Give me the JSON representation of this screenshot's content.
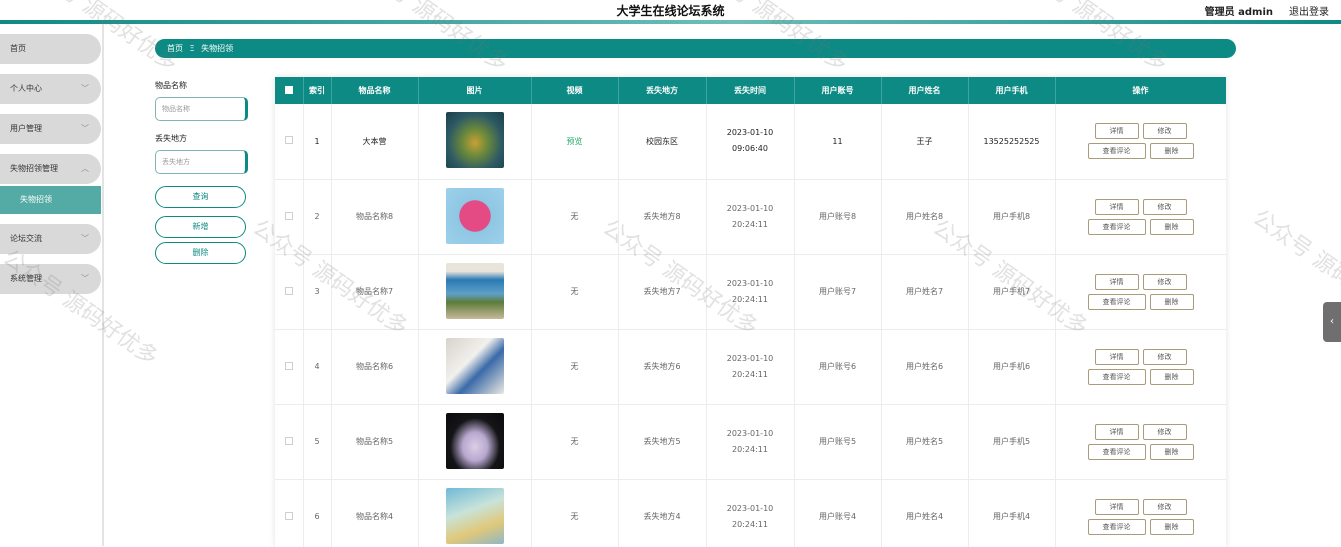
{
  "header": {
    "title": "大学生在线论坛系统",
    "admin_label": "管理员 admin",
    "logout_label": "退出登录"
  },
  "sidebar": {
    "items": [
      {
        "label": "首页",
        "chevron": false
      },
      {
        "label": "个人中心",
        "chevron": true
      },
      {
        "label": "用户管理",
        "chevron": true
      },
      {
        "label": "失物招领管理",
        "chevron": true
      },
      {
        "label": "论坛交流",
        "chevron": true
      },
      {
        "label": "系统管理",
        "chevron": true
      }
    ],
    "subitem": "失物招领"
  },
  "breadcrumb": {
    "home": "首页",
    "separator": "Ξ",
    "current": "失物招领"
  },
  "filters": {
    "item_name_label": "物品名称",
    "item_name_placeholder": "物品名称",
    "lost_place_label": "丢失地方",
    "lost_place_placeholder": "丢失地方",
    "query_button": "查询",
    "add_button": "新增",
    "delete_button": "删除"
  },
  "table": {
    "columns": [
      "",
      "索引",
      "物品名称",
      "图片",
      "视频",
      "丢失地方",
      "丢失时间",
      "用户账号",
      "用户姓名",
      "用户手机",
      "操作"
    ],
    "actions": {
      "detail": "详情",
      "edit": "修改",
      "comments": "查看评论",
      "delete": "删除"
    },
    "rows": [
      {
        "index": "1",
        "name": "大本营",
        "video": "预览",
        "place": "校园东区",
        "time": "2023-01-10 09:06:40",
        "account": "11",
        "username": "王子",
        "phone": "13525252525",
        "image_icon": "vase-photo"
      },
      {
        "index": "2",
        "name": "物品名称8",
        "video": "无",
        "place": "丢失地方8",
        "time": "2023-01-10 20:24:11",
        "account": "用户账号8",
        "username": "用户姓名8",
        "phone": "用户手机8",
        "image_icon": "pink-tag-photo"
      },
      {
        "index": "3",
        "name": "物品名称7",
        "video": "无",
        "place": "丢失地方7",
        "time": "2023-01-10 20:24:11",
        "account": "用户账号7",
        "username": "用户姓名7",
        "phone": "用户手机7",
        "image_icon": "card-photo"
      },
      {
        "index": "4",
        "name": "物品名称6",
        "video": "无",
        "place": "丢失地方6",
        "time": "2023-01-10 20:24:11",
        "account": "用户账号6",
        "username": "用户姓名6",
        "phone": "用户手机6",
        "image_icon": "id-card-photo"
      },
      {
        "index": "5",
        "name": "物品名称5",
        "video": "无",
        "place": "丢失地方5",
        "time": "2023-01-10 20:24:11",
        "account": "用户账号5",
        "username": "用户姓名5",
        "phone": "用户手机5",
        "image_icon": "tag-photo"
      },
      {
        "index": "6",
        "name": "物品名称4",
        "video": "无",
        "place": "丢失地方4",
        "time": "2023-01-10 20:24:11",
        "account": "用户账号4",
        "username": "用户姓名4",
        "phone": "用户手机4",
        "image_icon": "card-photo"
      }
    ]
  },
  "watermark": "公众号 源码好优多",
  "colors": {
    "accent": "#0d8a84",
    "sidebar_active": "#54aaa5",
    "link_green": "#1fa86a"
  }
}
